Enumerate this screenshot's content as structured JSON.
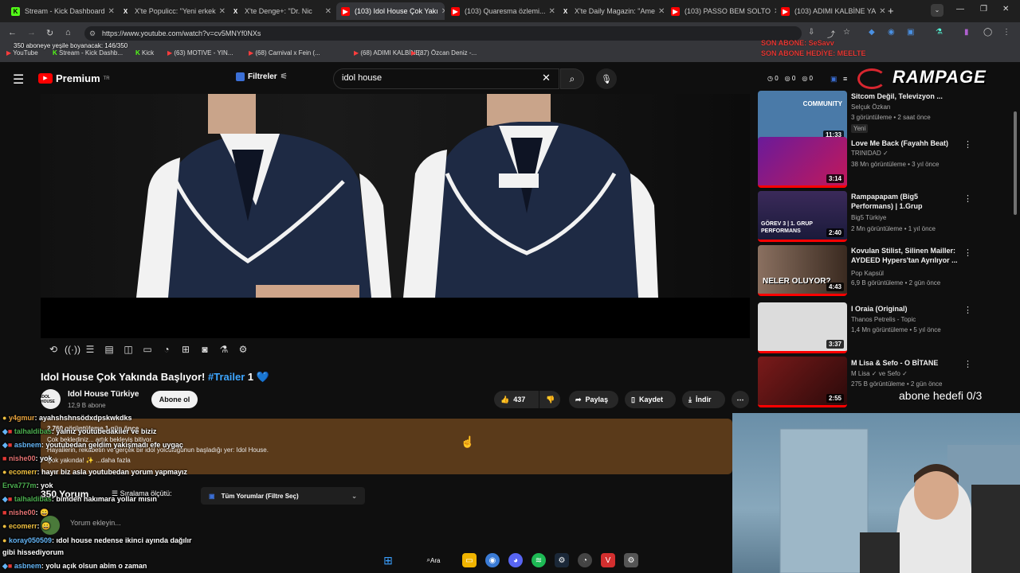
{
  "tabs": [
    {
      "label": "Stream - Kick Dashboard",
      "favicon": "K",
      "fav_color": "#53fc18"
    },
    {
      "label": "X'te Populicc: \"Yeni erkek",
      "favicon": "X",
      "fav_color": "#000000"
    },
    {
      "label": "X'te Denge+: \"Dr. Nic",
      "favicon": "X",
      "fav_color": "#000000"
    },
    {
      "label": "(103) Idol House Çok Yakı",
      "favicon": "▶",
      "fav_color": "#ff0000"
    },
    {
      "label": "(103) Quaresma özlemi...",
      "favicon": "▶",
      "fav_color": "#ff0000"
    },
    {
      "label": "X'te Daily Magazin: \"Ame",
      "favicon": "X",
      "fav_color": "#000000"
    },
    {
      "label": "(103) PASSO BEM SOLTO",
      "favicon": "▶",
      "fav_color": "#ff0000"
    },
    {
      "label": "(103) ADIMI KALBİNE YA",
      "favicon": "▶",
      "fav_color": "#ff0000"
    }
  ],
  "url": "https://www.youtube.com/watch?v=cv5MNYf0NXs",
  "bookmarks": [
    "YouTube",
    "Stream - Kick Dashb...",
    "Kick",
    "(63) MOTIVE - YIN...",
    "(68) Carnival x Fein (...",
    "(68) ADIMI KALBİNE...",
    "(87) Özcan Deniz -..."
  ],
  "overlay": {
    "abone_progress": "350 aboneye yeşile boyanacak: 146/350",
    "son_abone_1": "SON ABONE: SeSavv",
    "son_abone_2": "SON ABONE HEDİYE: MEELTE",
    "brand": "RAMPAGE",
    "abone_hedefi": "abone hedefi 0/3",
    "counters": [
      "0",
      "0",
      "0"
    ]
  },
  "header": {
    "logo": "Premium",
    "logo_sup": "TR",
    "filters": "Filtreler",
    "search_value": "idol house"
  },
  "video": {
    "title_main": "Idol House Çok Yakında Başlıyor! ",
    "title_tag": "#Trailer",
    "title_end": " 1 💙",
    "channel": "Idol House Türkiye",
    "subs": "12,9 B abone",
    "subscribe": "Abone ol",
    "likes": "437",
    "share": "Paylaş",
    "save": "Kaydet",
    "download": "İndir",
    "desc_views": "2.760 görüntüleme  1 gün önce",
    "desc_line1": "Çok beklediniz... artık bekleyiş bitiyor.",
    "desc_line2": "Hayallerin, rekabetin ve gerçek bir idol yolculuğunun başladığı yer: Idol House.",
    "desc_line3": "Çok yakında! ✨ ...daha fazla"
  },
  "comments": {
    "count": "350 Yorum",
    "sort": "Sıralama ölçütü:",
    "filter": "Tüm Yorumlar (Filtre Seç)",
    "placeholder": "Yorum ekleyin..."
  },
  "chat": [
    {
      "user": "y4gmur",
      "color": "#e8a33d",
      "text": ": ayahshshnsödxdpskwkdks"
    },
    {
      "user": "talhaldibas",
      "color": "#4caf50",
      "text": ": yalnız youtubedakiler ve biziz"
    },
    {
      "user": "asbnem",
      "color": "#64b5f6",
      "text": ": youtubedan geldim yakışmadı efe uygaç"
    },
    {
      "user": "nishe00",
      "color": "#e57373",
      "text": ": yok"
    },
    {
      "user": "ecomerr",
      "color": "#f0c040",
      "text": ": hayır biz asla youtubedan yorum yapmayız"
    },
    {
      "user": "Erva777m",
      "color": "#4caf50",
      "text": ": yok"
    },
    {
      "user": "talhaldibas",
      "color": "#4caf50",
      "text": ": bimden hakımara yollar mısın"
    },
    {
      "user": "nishe00",
      "color": "#e57373",
      "text": ": 😀"
    },
    {
      "user": "ecomerr",
      "color": "#f0c040",
      "text": ": 😀"
    },
    {
      "user": "koray050509",
      "color": "#64b5f6",
      "text": ": ıdol house nedense ikinci ayında dağılır"
    },
    {
      "user": "",
      "color": "#ffffff",
      "text": "gibi hissediyorum"
    },
    {
      "user": "asbnem",
      "color": "#64b5f6",
      "text": ": yolu açık olsun abim o zaman"
    }
  ],
  "sidebar": [
    {
      "title": "Sitcom Değil, Televizyon ...",
      "channel": "Selçuk Özkan",
      "meta": "3 görüntüleme • 2 saat önce",
      "badge": "Yeni",
      "duration": "11:33",
      "thumb_text": "COMMUNITY",
      "thumb_color": "#4a7aa8"
    },
    {
      "title": "Love Me Back (Fayahh Beat)",
      "channel": "TRINIDAD ✓",
      "meta": "38 Mn görüntüleme • 3 yıl önce",
      "badge": "",
      "duration": "3:14",
      "thumb_text": "",
      "thumb_color": "#6a1b9a"
    },
    {
      "title": "Rampapapam (Big5 Performans) | 1.Grup",
      "channel": "Big5 Türkiye",
      "meta": "2 Mn görüntüleme • 1 yıl önce",
      "badge": "",
      "duration": "2:40",
      "thumb_text": "GÖREV 3 | 1. GRUP PERFORMANS",
      "thumb_color": "#3b2a5a"
    },
    {
      "title": "Kovulan Stilist, Silinen Mailler: AYDEED Hypers'tan Ayrılıyor ...",
      "channel": "Pop Kapsül",
      "meta": "6,9 B görüntüleme • 2 gün önce",
      "badge": "",
      "duration": "4:43",
      "thumb_text": "NELER OLUYOR?",
      "thumb_color": "#5a4a3a"
    },
    {
      "title": "I Oraia (Original)",
      "channel": "Thanos Petrelis - Topic",
      "meta": "1,4 Mn görüntüleme • 5 yıl önce",
      "badge": "",
      "duration": "3:37",
      "thumb_text": "",
      "thumb_color": "#d8d8d8"
    },
    {
      "title": "M Lisa & Sefo - O BİTANE",
      "channel": "M Lisa ✓ ve Sefo ✓",
      "meta": "275 B görüntüleme • 2 gün önce",
      "badge": "",
      "duration": "2:55",
      "thumb_text": "",
      "thumb_color": "#7a1a1a"
    }
  ],
  "taskbar": {
    "search": "Ara"
  }
}
